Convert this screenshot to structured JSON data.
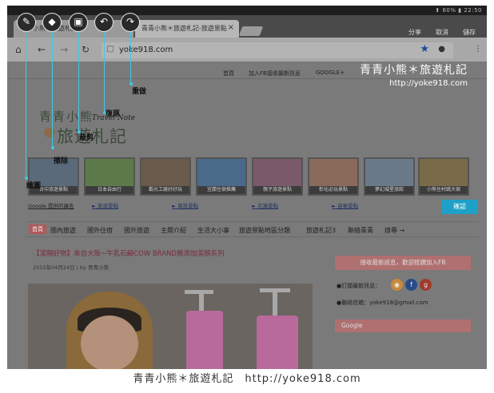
{
  "status": {
    "battery": "60%",
    "time": "22:50"
  },
  "tabs": [
    {
      "label": "青青小熊＊旅遊札記",
      "active": false
    },
    {
      "label": "青青小熊＊旅遊札記-旅遊景點",
      "active": true
    }
  ],
  "top_right": {
    "share": "分享",
    "cancel": "取消",
    "save": "儲存"
  },
  "browser": {
    "url": "yoke918.com"
  },
  "site_nav": [
    "首頁",
    "加入FB接收最新訊息",
    "GOOGLE+"
  ],
  "watermark": {
    "line1": "青青小熊＊旅遊札記",
    "line2": "http://yoke918.com"
  },
  "blog": {
    "title_line1": "青青小熊",
    "title_line2": "旅遊札記",
    "subtitle": "Travel Note"
  },
  "thumbnails": [
    "台中旅遊景點",
    "日本自由行",
    "觀光工廠好好玩",
    "宜蘭住宿推薦",
    "親子旅遊景點",
    "彰化必玩景點",
    "夢幻城堡旅館",
    "小熊住村跳大宿"
  ],
  "links": [
    "Google 提供的廣告",
    "► 旅遊景點",
    "► 南投景點",
    "► 花蓮景點",
    "► 苗栗景點"
  ],
  "confirm_button": "確認",
  "categories": [
    "國內旅遊",
    "國外住宿",
    "國外旅遊",
    "主題介紹",
    "生活大小事",
    "旅遊景點地區分類",
    "旅遊札記3",
    "聯絡青青",
    "搜尋 →"
  ],
  "category_home": "首頁",
  "post": {
    "title": "【潔顏好物】來自大阪~牛乳石鹼COW BRAND無添加潔顏系列",
    "date": "2015年04月24日 | by 青青小熊"
  },
  "sidebar": {
    "fb_box": "接收最新訊息，歡迎按讚加入FB",
    "subscribe": "●訂閱最新訊息：",
    "mail_label": "●聯絡信箱：",
    "mail": "yoke918@gmail.com",
    "google_box": "Google"
  },
  "annotations": {
    "draw": "繪圖",
    "erase": "擦除",
    "crop": "裁剪",
    "undo": "復原",
    "redo": "重做"
  },
  "caption": "青青小熊＊旅遊札記　http://yoke918.com",
  "colors": {
    "annotation_line": "#3ec9e8",
    "confirm": "#1fa0c8",
    "accent": "#b07070"
  }
}
